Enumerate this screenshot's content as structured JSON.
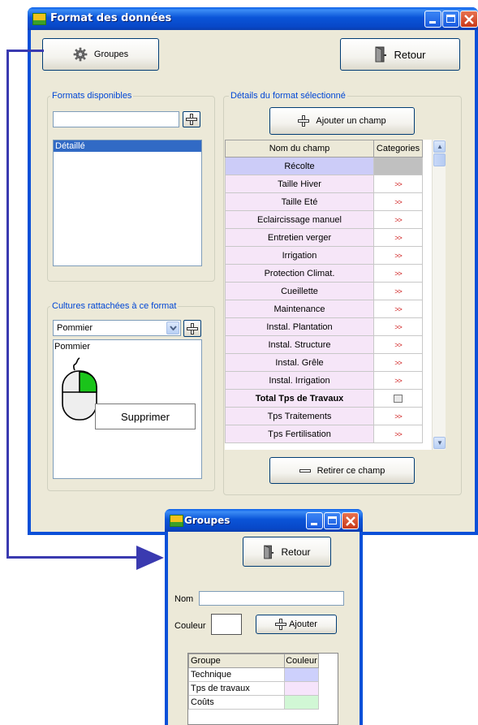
{
  "main_window": {
    "title": "Format des données",
    "groupes_button": "Groupes",
    "retour_button": "Retour",
    "formats_group": {
      "label": "Formats disponibles",
      "input_value": "",
      "items": [
        "Détaillé"
      ],
      "selected_index": 0
    },
    "cultures_group": {
      "label": "Cultures rattachées à ce format",
      "select_value": "Pommier",
      "items": [
        "Pommier"
      ]
    },
    "context_menu": {
      "item": "Supprimer"
    },
    "details_group": {
      "label": "Détails du format sélectionné",
      "add_button": "Ajouter un champ",
      "remove_button": "Retirer ce champ",
      "columns": [
        "Nom du champ",
        "Categories"
      ],
      "rows": [
        {
          "name": "Récolte",
          "cat": "",
          "bold": false,
          "group": "blue"
        },
        {
          "name": "Taille Hiver",
          "cat": ">>",
          "bold": false,
          "group": "pink"
        },
        {
          "name": "Taille Eté",
          "cat": ">>",
          "bold": false,
          "group": "pink"
        },
        {
          "name": "Eclaircissage manuel",
          "cat": ">>",
          "bold": false,
          "group": "pink"
        },
        {
          "name": "Entretien verger",
          "cat": ">>",
          "bold": false,
          "group": "pink"
        },
        {
          "name": "Irrigation",
          "cat": ">>",
          "bold": false,
          "group": "pink"
        },
        {
          "name": "Protection Climat.",
          "cat": ">>",
          "bold": false,
          "group": "pink"
        },
        {
          "name": "Cueillette",
          "cat": ">>",
          "bold": false,
          "group": "pink"
        },
        {
          "name": "Maintenance",
          "cat": ">>",
          "bold": false,
          "group": "pink"
        },
        {
          "name": "Instal. Plantation",
          "cat": ">>",
          "bold": false,
          "group": "pink"
        },
        {
          "name": "Instal. Structure",
          "cat": ">>",
          "bold": false,
          "group": "pink"
        },
        {
          "name": "Instal. Grêle",
          "cat": ">>",
          "bold": false,
          "group": "pink"
        },
        {
          "name": "Instal. Irrigation",
          "cat": ">>",
          "bold": false,
          "group": "pink"
        },
        {
          "name": "Total Tps de Travaux",
          "cat": "calc",
          "bold": true,
          "group": "pink"
        },
        {
          "name": "Tps Traitements",
          "cat": ">>",
          "bold": false,
          "group": "pink"
        },
        {
          "name": "Tps Fertilisation",
          "cat": ">>",
          "bold": false,
          "group": "pink"
        }
      ]
    }
  },
  "groupes_window": {
    "title": "Groupes",
    "retour_button": "Retour",
    "nom_label": "Nom",
    "nom_value": "",
    "couleur_label": "Couleur",
    "ajouter_button": "Ajouter",
    "columns": [
      "Groupe",
      "Couleur"
    ],
    "rows": [
      {
        "name": "Technique",
        "color": "#cdd0fc"
      },
      {
        "name": "Tps de travaux",
        "color": "#f6e4fb"
      },
      {
        "name": "Coûts",
        "color": "#d1f7d5"
      }
    ]
  },
  "colors": {
    "xp_blue": "#0a50d8",
    "client_bg": "#ece9d8",
    "selection": "#316ac5",
    "row_blue": "#ccccf8",
    "row_pink": "#f6e6f8",
    "arrow_line": "#3a3ab0"
  }
}
